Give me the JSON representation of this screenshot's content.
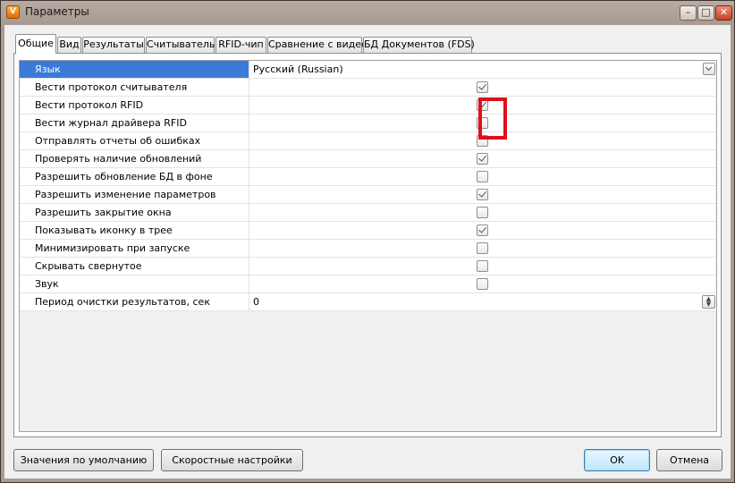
{
  "window": {
    "title": "Параметры",
    "app_icon_glyph": "V",
    "controls": {
      "minimize": "–",
      "maximize": "□",
      "close": "✕"
    }
  },
  "tabs": [
    {
      "label": "Общие",
      "active": true
    },
    {
      "label": "Вид",
      "active": false
    },
    {
      "label": "Результаты",
      "active": false
    },
    {
      "label": "Считыватель",
      "active": false
    },
    {
      "label": "RFID-чип",
      "active": false
    },
    {
      "label": "Сравнение с видео",
      "active": false
    },
    {
      "label": "БД Документов (FDS)",
      "active": false
    }
  ],
  "settings": [
    {
      "name": "Язык",
      "type": "combo",
      "value": "Русский (Russian)",
      "selected": true
    },
    {
      "name": "Вести протокол считывателя",
      "type": "checkbox",
      "checked": true
    },
    {
      "name": "Вести протокол RFID",
      "type": "checkbox",
      "checked": true
    },
    {
      "name": "Вести журнал драйвера RFID",
      "type": "checkbox",
      "checked": false
    },
    {
      "name": "Отправлять отчеты об ошибках",
      "type": "checkbox",
      "checked": false
    },
    {
      "name": "Проверять наличие обновлений",
      "type": "checkbox",
      "checked": true
    },
    {
      "name": "Разрешить обновление БД в фоне",
      "type": "checkbox",
      "checked": false
    },
    {
      "name": "Разрешить изменение параметров",
      "type": "checkbox",
      "checked": true
    },
    {
      "name": "Разрешить закрытие окна",
      "type": "checkbox",
      "checked": false
    },
    {
      "name": "Показывать иконку в трее",
      "type": "checkbox",
      "checked": true
    },
    {
      "name": "Минимизировать при запуске",
      "type": "checkbox",
      "checked": false
    },
    {
      "name": "Скрывать свернутое",
      "type": "checkbox",
      "checked": false
    },
    {
      "name": "Звук",
      "type": "checkbox",
      "checked": false
    },
    {
      "name": "Период очистки результатов, сек",
      "type": "number",
      "value": "0"
    }
  ],
  "buttons": {
    "defaults": "Значения по умолчанию",
    "quick_settings": "Скоростные настройки",
    "ok": "OK",
    "cancel": "Отмена"
  },
  "colors": {
    "selection": "#3b7ad8",
    "highlight_box": "#e00f1a"
  }
}
